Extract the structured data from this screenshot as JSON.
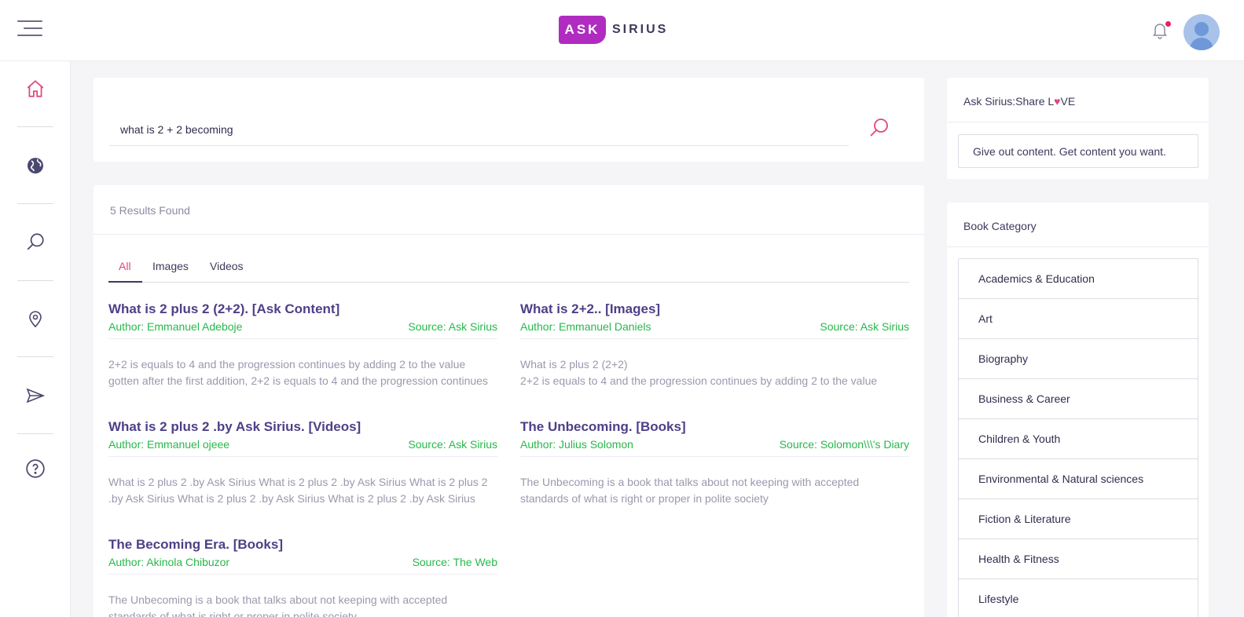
{
  "app": {
    "logo_left": "ASK",
    "logo_right": "SIRIUS"
  },
  "sidebar": {
    "items": [
      {
        "icon": "home-icon"
      },
      {
        "icon": "globe-icon"
      },
      {
        "icon": "search-icon"
      },
      {
        "icon": "location-pin-icon"
      },
      {
        "icon": "send-icon"
      },
      {
        "icon": "help-icon"
      }
    ]
  },
  "search": {
    "value": "what is 2 + 2 becoming"
  },
  "results": {
    "count_text": "5 Results Found",
    "tabs": [
      {
        "label": "All",
        "active": true
      },
      {
        "label": "Images",
        "active": false
      },
      {
        "label": "Videos",
        "active": false
      }
    ],
    "items": [
      {
        "title": "What is 2 plus 2 (2+2). [Ask Content]",
        "author": "Author: Emmanuel Adeboje",
        "source": "Source: Ask Sirius",
        "snippet": "2+2 is equals to 4 and the progression continues by adding 2 to the value gotten after the first addition, 2+2 is equals to 4 and the progression continues"
      },
      {
        "title": "What is 2+2.. [Images]",
        "author": "Author: Emmanuel Daniels",
        "source": "Source: Ask Sirius",
        "snippet": "What is 2 plus 2 (2+2)\n2+2 is equals to 4 and the progression continues by adding 2 to the value"
      },
      {
        "title": "What is 2 plus 2 .by Ask Sirius. [Videos]",
        "author": "Author: Emmanuel ojeee",
        "source": "Source: Ask Sirius",
        "snippet": "What is 2 plus 2 .by Ask Sirius What is 2 plus 2 .by Ask Sirius What is 2 plus 2 .by Ask Sirius What is 2 plus 2 .by Ask Sirius What is 2 plus 2 .by Ask Sirius"
      },
      {
        "title": "The Unbecoming. [Books]",
        "author": "Author: Julius Solomon",
        "source": "Source: Solomon\\\\\\'s Diary",
        "snippet": "The Unbecoming is a book that talks about not keeping with accepted standards of what is right or proper in polite society"
      },
      {
        "title": "The Becoming Era. [Books]",
        "author": "Author: Akinola Chibuzor",
        "source": "Source: The Web",
        "snippet": "The Unbecoming is a book that talks about not keeping with accepted standards of what is right or proper in polite society"
      }
    ]
  },
  "share": {
    "title_before": "Ask Sirius:Share L",
    "heart": "♥",
    "title_after": "VE",
    "tagline": "Give out content. Get content you want."
  },
  "categories": {
    "title": "Book Category",
    "items": [
      "Academics & Education",
      "Art",
      "Biography",
      "Business & Career",
      "Children & Youth",
      "Environmental & Natural sciences",
      "Fiction & Literature",
      "Health & Fitness",
      "Lifestyle"
    ]
  },
  "colors": {
    "accent": "#e0467c",
    "brand": "#b02cc0",
    "title": "#4f3f87",
    "meta": "#27b84b"
  }
}
